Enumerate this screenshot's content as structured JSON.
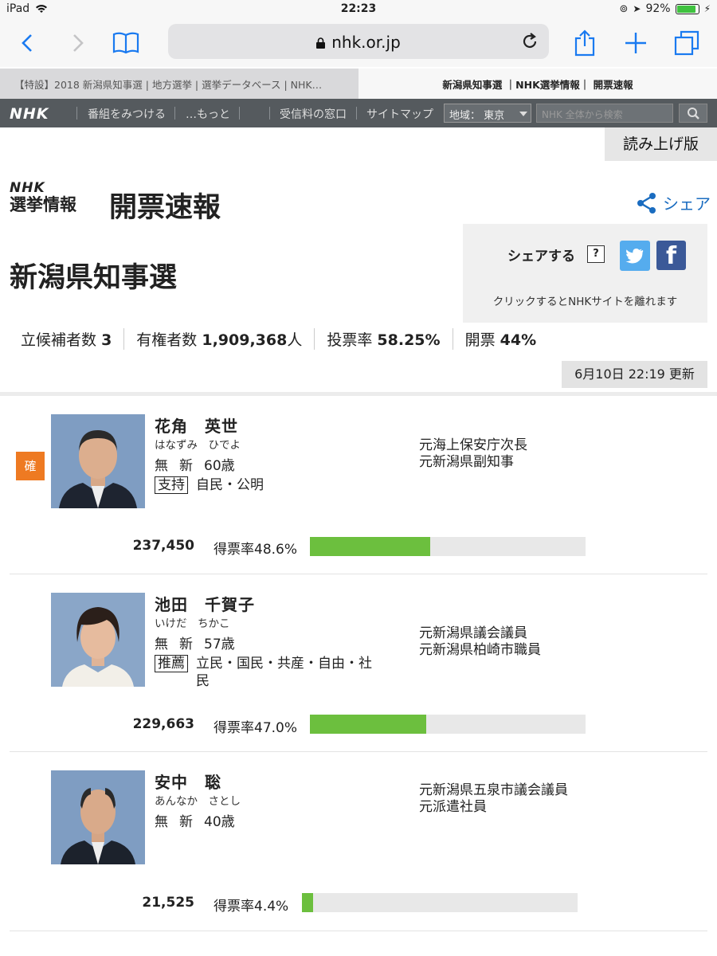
{
  "status": {
    "device": "iPad",
    "time": "22:23",
    "battery": "92%"
  },
  "browser": {
    "url": "nhk.or.jp",
    "tabs": [
      {
        "label": "【特設】2018 新潟県知事選 | 地方選挙 | 選挙データベース | NHK…",
        "active": false
      },
      {
        "label": "新潟県知事選 ｜NHK選挙情報｜ 開票速報",
        "active": true
      }
    ]
  },
  "nav": {
    "logo": "NHK",
    "items": [
      "番組をみつける",
      "…もっと",
      "受信料の窓口",
      "サイトマップ"
    ],
    "region": "地域： 東京",
    "search_placeholder": "NHK 全体から検索"
  },
  "yomiage": "読み上げ版",
  "header": {
    "logo_nhk": "NHK",
    "logo_senkyo": "選挙情報",
    "page_title": "開票速報",
    "share": "シェア",
    "election_title": "新潟県知事選"
  },
  "sharebox": {
    "label": "シェアする",
    "help": "?",
    "note": "クリックするとNHKサイトを離れます"
  },
  "stats": {
    "candidates_label": "立候補者数",
    "candidates_value": "3",
    "voters_label": "有権者数",
    "voters_value": "1,909,368",
    "voters_unit": "人",
    "turnout_label": "投票率",
    "turnout_value": "58.25%",
    "counted_label": "開票",
    "counted_value": "44%"
  },
  "updated": "6月10日 22:19 更新",
  "candidates": [
    {
      "elected_mark": "確",
      "name": "花角　英世",
      "kana": "はなずみ　ひでよ",
      "party": "無",
      "status": "新",
      "age": "60歳",
      "support_tag": "支持",
      "support_parties": "自民・公明",
      "career": [
        "元海上保安庁次長",
        "元新潟県副知事"
      ],
      "votes": "237,450",
      "rate_label": "得票率48.6%",
      "rate": 48.6
    },
    {
      "elected_mark": "",
      "name": "池田　千賀子",
      "kana": "いけだ　ちかこ",
      "party": "無",
      "status": "新",
      "age": "57歳",
      "support_tag": "推薦",
      "support_parties": "立民・国民・共産・自由・社民",
      "career": [
        "元新潟県議会議員",
        "元新潟県柏崎市職員"
      ],
      "votes": "229,663",
      "rate_label": "得票率47.0%",
      "rate": 47.0
    },
    {
      "elected_mark": "",
      "name": "安中　聡",
      "kana": "あんなか　さとし",
      "party": "無",
      "status": "新",
      "age": "40歳",
      "support_tag": "",
      "support_parties": "",
      "career": [
        "元新潟県五泉市議会議員",
        "元派遣社員"
      ],
      "votes": "21,525",
      "rate_label": "得票率4.4%",
      "rate": 4.4
    }
  ],
  "colors": {
    "bar_fill": "#6cbf3e",
    "bar_bg": "#e8e8e8",
    "elected_badge": "#ee7a22",
    "share_link": "#1a6cc0",
    "twitter": "#55acee",
    "facebook": "#3b5998"
  }
}
